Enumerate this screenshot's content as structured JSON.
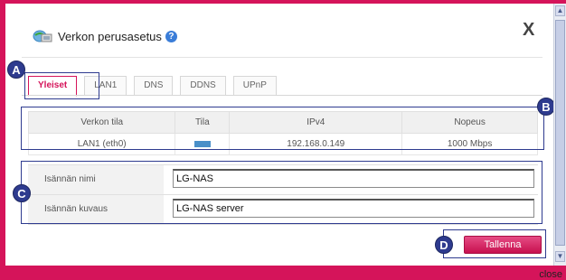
{
  "dialog": {
    "title": "Verkon perusasetus",
    "help_glyph": "?",
    "close_glyph": "X",
    "close_text": "close"
  },
  "tabs": [
    {
      "label": "Yleiset",
      "active": true
    },
    {
      "label": "LAN1",
      "active": false
    },
    {
      "label": "DNS",
      "active": false
    },
    {
      "label": "DDNS",
      "active": false
    },
    {
      "label": "UPnP",
      "active": false
    }
  ],
  "status_table": {
    "headers": [
      "Verkon tila",
      "Tila",
      "IPv4",
      "Nopeus"
    ],
    "row": {
      "network": "LAN1 (eth0)",
      "status_color": "#4a90c8",
      "ipv4": "192.168.0.149",
      "speed": "1000 Mbps"
    }
  },
  "form": {
    "host_name_label": "Isännän nimi",
    "host_name_value": "LG-NAS",
    "host_desc_label": "Isännän kuvaus",
    "host_desc_value": "LG-NAS server"
  },
  "save_label": "Tallenna",
  "markers": {
    "a": "A",
    "b": "B",
    "c": "C",
    "d": "D"
  },
  "colors": {
    "accent": "#d5145a",
    "marker": "#2e3b8f"
  }
}
